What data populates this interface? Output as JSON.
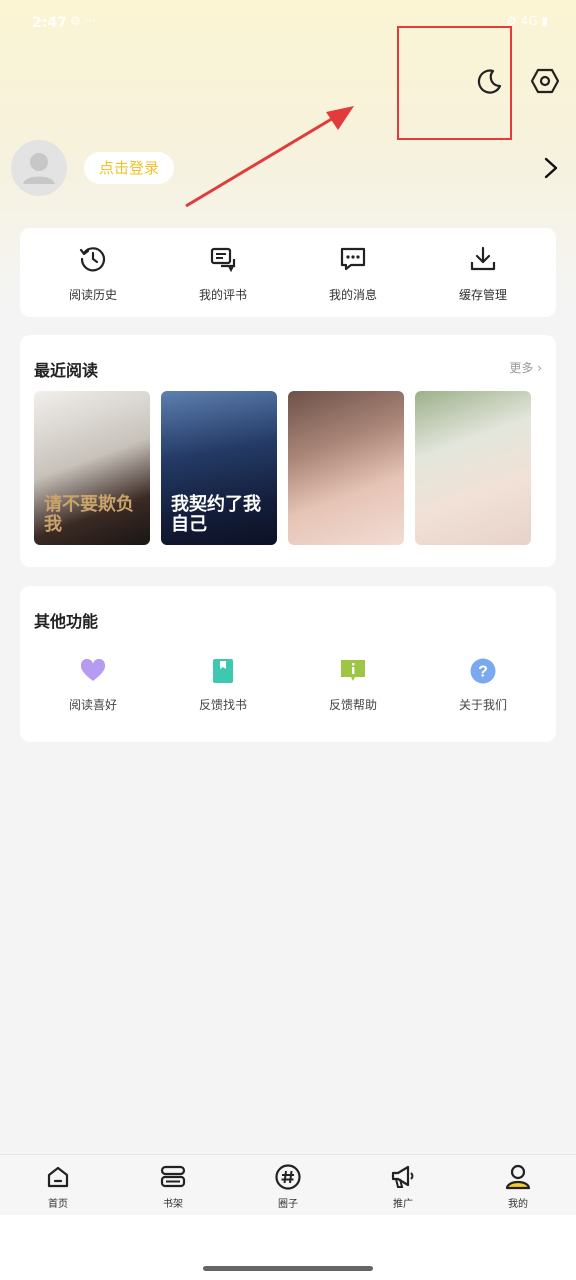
{
  "status_bar": {
    "time": "2:47",
    "extra": "⚙ ···",
    "right": "⚙ 4G ▮"
  },
  "header": {
    "moon_icon": "moon-icon",
    "settings_icon": "settings-hexagon-icon",
    "annotation_color": "#e23b3b"
  },
  "profile": {
    "login_label": "点击登录",
    "login_color": "#f2c22b"
  },
  "quick_actions": [
    {
      "label": "阅读历史",
      "icon": "clock-history-icon"
    },
    {
      "label": "我的评书",
      "icon": "comment-book-icon"
    },
    {
      "label": "我的消息",
      "icon": "message-icon"
    },
    {
      "label": "缓存管理",
      "icon": "download-icon"
    }
  ],
  "recent": {
    "title": "最近阅读",
    "more": "更多",
    "covers": [
      {
        "text": "请不要欺负我"
      },
      {
        "text": "我契约了我自己"
      },
      {
        "text": ""
      },
      {
        "text": ""
      }
    ]
  },
  "other": {
    "title": "其他功能",
    "items": [
      {
        "label": "阅读喜好",
        "icon": "heart-icon",
        "color": "#b69cf0"
      },
      {
        "label": "反馈找书",
        "icon": "bookmark-icon",
        "color": "#3ec8b0"
      },
      {
        "label": "反馈帮助",
        "icon": "info-chat-icon",
        "color": "#9fc545"
      },
      {
        "label": "关于我们",
        "icon": "question-icon",
        "color": "#7aa9f0"
      }
    ]
  },
  "bottom_nav": [
    {
      "label": "首页",
      "icon": "home-icon"
    },
    {
      "label": "书架",
      "icon": "bookshelf-icon"
    },
    {
      "label": "圈子",
      "icon": "hashtag-icon"
    },
    {
      "label": "推广",
      "icon": "megaphone-icon"
    },
    {
      "label": "我的",
      "icon": "profile-icon",
      "active": true
    }
  ]
}
